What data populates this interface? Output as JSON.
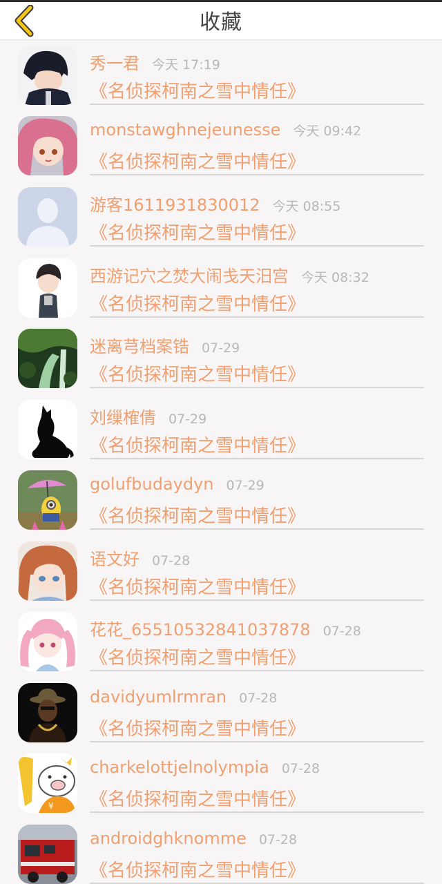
{
  "header": {
    "title": "收藏",
    "back_icon": "chevron-left-icon",
    "accent": "#f5c518"
  },
  "colors": {
    "name": "#f0a070",
    "time": "#b8b8b8",
    "title": "#f0a070",
    "background": "#f7f5f5"
  },
  "favorites": [
    {
      "name": "秀一君",
      "time": "今天 17:19",
      "title": "《名侦探柯南之雪中情任》",
      "avatar": "anime-boy-avatar"
    },
    {
      "name": "monstawghnejeunesse",
      "time": "今天 09:42",
      "title": "《名侦探柯南之雪中情任》",
      "avatar": "pink-hair-girl-avatar"
    },
    {
      "name": "游客1611931830012",
      "time": "今天 08:55",
      "title": "《名侦探柯南之雪中情任》",
      "avatar": "default-user-avatar"
    },
    {
      "name": "西游记穴之焚大闹戋天汨宫",
      "time": "今天 08:32",
      "title": "《名侦探柯南之雪中情任》",
      "avatar": "chibi-character-avatar"
    },
    {
      "name": "迷离芎档案锆",
      "time": "07-29",
      "title": "《名侦探柯南之雪中情任》",
      "avatar": "waterfall-avatar"
    },
    {
      "name": "刘缫榷倩",
      "time": "07-29",
      "title": "《名侦探柯南之雪中情任》",
      "avatar": "black-cat-avatar"
    },
    {
      "name": "golufbudaydyn",
      "time": "07-29",
      "title": "《名侦探柯南之雪中情任》",
      "avatar": "minion-umbrella-avatar"
    },
    {
      "name": "语文好",
      "time": "07-28",
      "title": "《名侦探柯南之雪中情任》",
      "avatar": "anime-girl-brown-hair-avatar"
    },
    {
      "name": "花花_65510532841037878",
      "time": "07-28",
      "title": "《名侦探柯南之雪中情任》",
      "avatar": "pink-twintail-girl-avatar"
    },
    {
      "name": "davidyumlrmran",
      "time": "07-28",
      "title": "《名侦探柯南之雪中情任》",
      "avatar": "man-with-hat-avatar"
    },
    {
      "name": "charkelottjelnolympia",
      "time": "07-28",
      "title": "《名侦探柯南之雪中情任》",
      "avatar": "cartoon-pig-avatar"
    },
    {
      "name": "androidghknomme",
      "time": "07-28",
      "title": "《名侦探柯南之雪中情任》",
      "avatar": "fire-truck-avatar"
    }
  ]
}
